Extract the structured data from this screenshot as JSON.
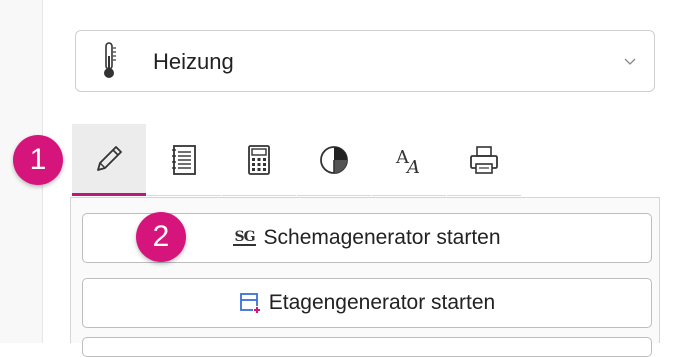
{
  "dropdown": {
    "selected": "Heizung",
    "icon": "thermometer-icon"
  },
  "tabs": [
    {
      "icon": "pencil-icon",
      "active": true
    },
    {
      "icon": "notebook-icon",
      "active": false
    },
    {
      "icon": "calculator-icon",
      "active": false
    },
    {
      "icon": "pie-chart-icon",
      "active": false
    },
    {
      "icon": "font-size-icon",
      "active": false
    },
    {
      "icon": "printer-icon",
      "active": false
    }
  ],
  "buttons": {
    "schema": {
      "label": "Schemagenerator starten",
      "icon_text": "SG"
    },
    "etage": {
      "label": "Etagengenerator starten"
    }
  },
  "badges": {
    "one": "1",
    "two": "2"
  },
  "colors": {
    "accent": "#d6157c",
    "active_underline": "#c0157a",
    "etage_icon_blue": "#3b6fd6",
    "etage_icon_plus": "#d6157c"
  }
}
